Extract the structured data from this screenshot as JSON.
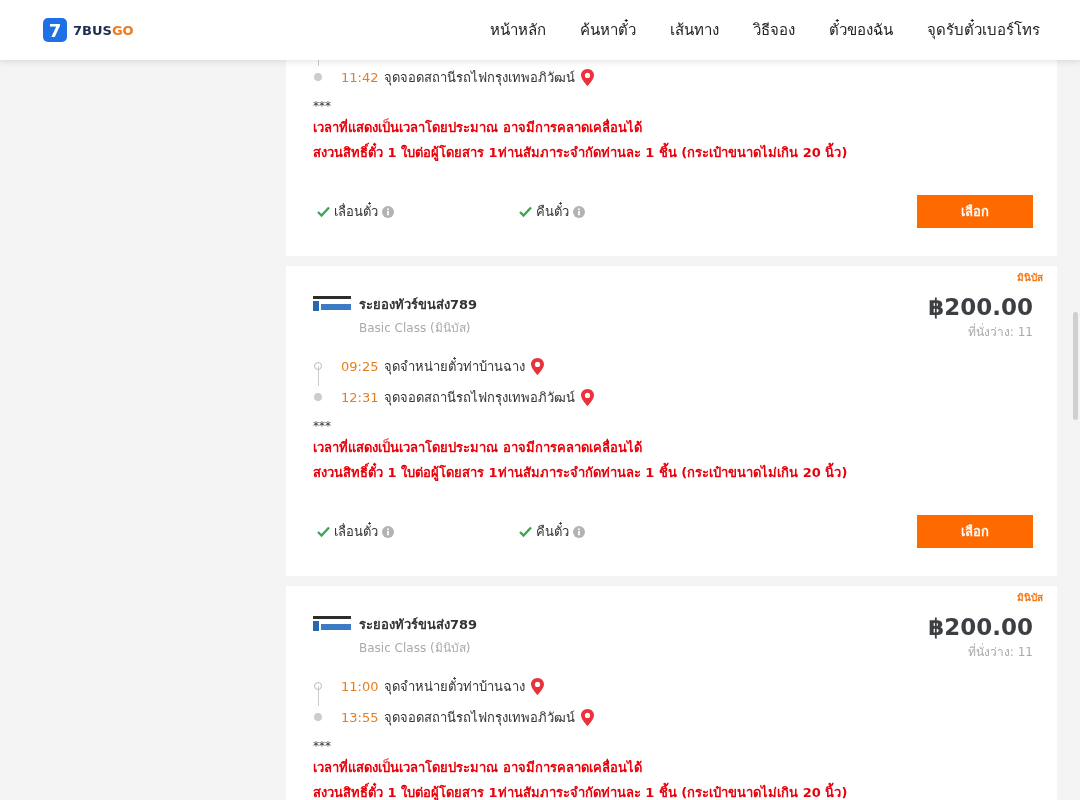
{
  "header": {
    "logo": {
      "mark": "7",
      "name_main": "7BUS",
      "name_accent": "GO"
    },
    "nav": [
      "หน้าหลัก",
      "ค้นหาตั๋ว",
      "เส้นทาง",
      "วิธีจอง",
      "ตั๋วของฉัน",
      "จุดรับตั๋วเบอร์โทร"
    ]
  },
  "trips": [
    {
      "stops": [
        {
          "kind": "arrival",
          "time": "11:42",
          "place": "จุดจอดสถานีรถไฟกรุงเทพอภิวัฒน์"
        }
      ],
      "notes_marker": "***",
      "notes": [
        "เวลาที่แสดงเป็นเวลาโดยประมาณ อาจมีการคลาดเคลื่อนได้",
        "สงวนสิทธิ์ตั๋ว 1 ใบต่อผู้โดยสาร 1ท่านสัมภาระจำกัดท่านละ 1 ชิ้น (กระเป๋าขนาดไม่เกิน 20 นิ้ว)"
      ],
      "features": [
        "เลื่อนตั๋ว",
        "คืนตั๋ว"
      ],
      "button": "เลือก"
    },
    {
      "tag": "มินิบัส",
      "operator": "ระยองทัวร์ขนส่ง789",
      "bus_class": "Basic Class (มินิบัส)",
      "price": "฿200.00",
      "seats": "ที่นั่งว่าง: 11",
      "stops": [
        {
          "kind": "departure",
          "time": "09:25",
          "place": "จุดจำหน่ายตั๋วท่าบ้านฉาง"
        },
        {
          "kind": "arrival",
          "time": "12:31",
          "place": "จุดจอดสถานีรถไฟกรุงเทพอภิวัฒน์"
        }
      ],
      "notes_marker": "***",
      "notes": [
        "เวลาที่แสดงเป็นเวลาโดยประมาณ อาจมีการคลาดเคลื่อนได้",
        "สงวนสิทธิ์ตั๋ว 1 ใบต่อผู้โดยสาร 1ท่านสัมภาระจำกัดท่านละ 1 ชิ้น (กระเป๋าขนาดไม่เกิน 20 นิ้ว)"
      ],
      "features": [
        "เลื่อนตั๋ว",
        "คืนตั๋ว"
      ],
      "button": "เลือก"
    },
    {
      "tag": "มินิบัส",
      "operator": "ระยองทัวร์ขนส่ง789",
      "bus_class": "Basic Class (มินิบัส)",
      "price": "฿200.00",
      "seats": "ที่นั่งว่าง: 11",
      "stops": [
        {
          "kind": "departure",
          "time": "11:00",
          "place": "จุดจำหน่ายตั๋วท่าบ้านฉาง"
        },
        {
          "kind": "arrival",
          "time": "13:55",
          "place": "จุดจอดสถานีรถไฟกรุงเทพอภิวัฒน์"
        }
      ],
      "notes_marker": "***",
      "notes": [
        "เวลาที่แสดงเป็นเวลาโดยประมาณ อาจมีการคลาดเคลื่อนได้",
        "สงวนสิทธิ์ตั๋ว 1 ใบต่อผู้โดยสาร 1ท่านสัมภาระจำกัดท่านละ 1 ชิ้น (กระเป๋าขนาดไม่เกิน 20 นิ้ว)"
      ]
    }
  ]
}
